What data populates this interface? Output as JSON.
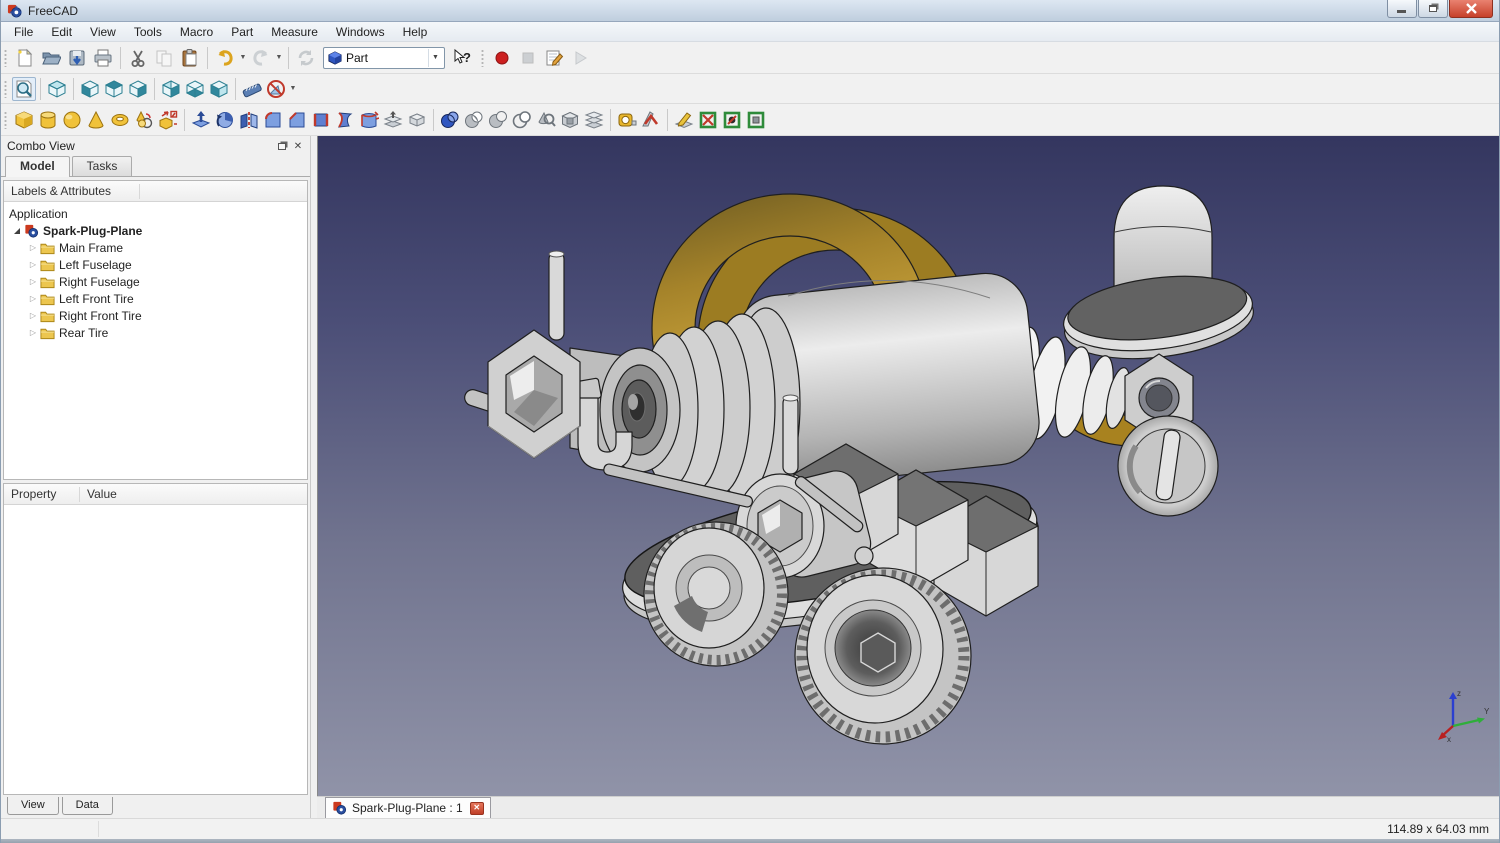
{
  "window": {
    "title": "FreeCAD"
  },
  "menu": {
    "items": [
      "File",
      "Edit",
      "View",
      "Tools",
      "Macro",
      "Part",
      "Measure",
      "Windows",
      "Help"
    ]
  },
  "toolbars": {
    "file_icons": [
      "file-new",
      "file-open",
      "file-save",
      "print",
      "cut",
      "copy",
      "paste",
      "undo",
      "redo",
      "refresh"
    ],
    "workbench": {
      "selected": "Part"
    },
    "macro_icons": [
      "macro-record",
      "macro-stop",
      "macro-edit",
      "macro-execute"
    ],
    "view_icons": [
      "fit-all",
      "view-axonometric",
      "view-front",
      "view-top",
      "view-right",
      "view-rear",
      "view-bottom",
      "view-left",
      "measure-distance",
      "clear-measurement"
    ],
    "part_icons": [
      "box",
      "cylinder",
      "sphere",
      "cone",
      "torus",
      "create-primitives",
      "shape-builder",
      "extrude",
      "revolve",
      "mirror",
      "fillet",
      "chamfer",
      "make-face",
      "ruled-surface",
      "loft",
      "offset",
      "thickness",
      "boolean-union",
      "boolean-common",
      "boolean-cut",
      "boolean-section",
      "check-geometry",
      "boolean-operation",
      "cross-sections",
      "measure-linear",
      "measure-angular",
      "measure-refresh",
      "measure-clear-all",
      "measure-toggle-all",
      "measure-toggle-delta"
    ]
  },
  "combo_view": {
    "title": "Combo View",
    "tabs": [
      {
        "label": "Model"
      },
      {
        "label": "Tasks"
      }
    ],
    "tree_header": "Labels & Attributes",
    "tree": {
      "root": "Application",
      "document": "Spark-Plug-Plane",
      "items": [
        {
          "label": "Main Frame"
        },
        {
          "label": "Left Fuselage"
        },
        {
          "label": "Right Fuselage"
        },
        {
          "label": "Left Front Tire"
        },
        {
          "label": "Right Front Tire"
        },
        {
          "label": "Rear Tire"
        }
      ]
    },
    "properties": {
      "columns": [
        "Property",
        "Value"
      ],
      "rows": []
    },
    "bottom_tabs": [
      "View",
      "Data"
    ]
  },
  "viewport": {
    "document_tab": "Spark-Plug-Plane : 1",
    "axis_labels": {
      "x": "x",
      "y": "Y",
      "z": "z"
    }
  },
  "statusbar": {
    "dimensions": "114.89 x 64.03 mm"
  },
  "colors": {
    "viewport_top": "#34365f",
    "viewport_bottom": "#9093a8",
    "gold": "#c49a2e",
    "metal": "#cfcfcf",
    "close_red": "#c6402a"
  }
}
